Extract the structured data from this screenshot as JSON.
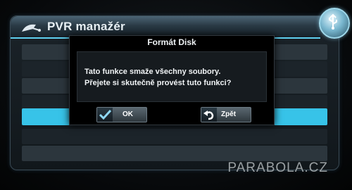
{
  "window": {
    "title": "PVR manažér",
    "logo_icon": "satellite-dish-icon",
    "badge_icon": "usb-icon"
  },
  "list": {
    "selected_color": "#37c3e8"
  },
  "dialog": {
    "title": "Formát Disk",
    "message_line1": "Tato funkce smaže všechny soubory.",
    "message_line2": "Přejete si skutečně provést tuto funkci?",
    "ok_label": "OK",
    "ok_icon": "checkmark-icon",
    "back_label": "Zpět",
    "back_icon": "undo-arrow-icon"
  },
  "watermark": "PARABOLA.CZ"
}
